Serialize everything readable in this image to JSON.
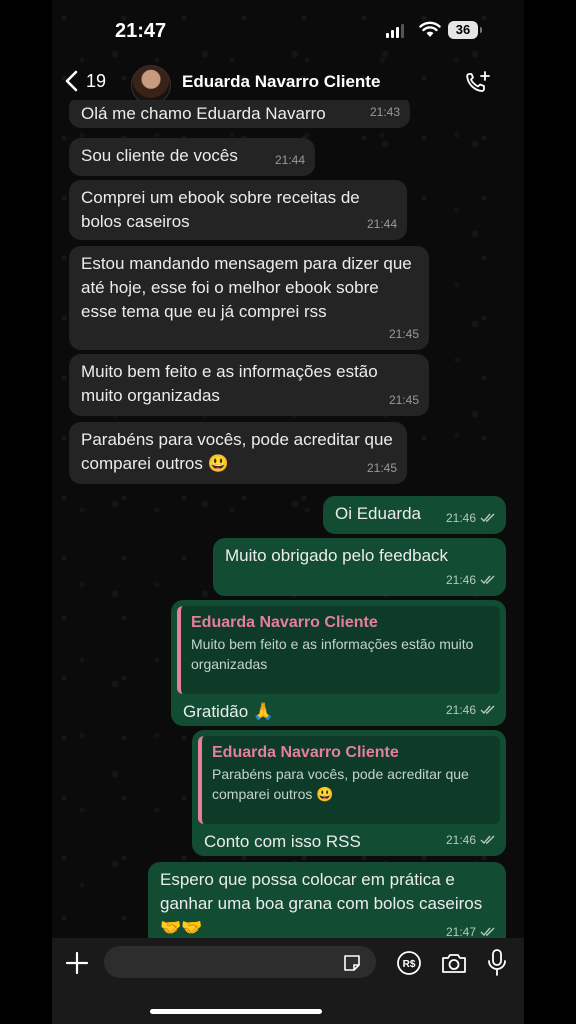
{
  "status_bar": {
    "time": "21:47",
    "battery": "36"
  },
  "header": {
    "back_count": "19",
    "contact_name": "Eduarda Navarro Cliente"
  },
  "messages": [
    {
      "text": "Olá me chamo Eduarda Navarro",
      "time": "21:43"
    },
    {
      "text": "Sou cliente de vocês",
      "time": "21:44"
    },
    {
      "text": "Comprei um ebook sobre receitas de bolos caseiros",
      "time": "21:44"
    },
    {
      "text": "Estou mandando mensagem para dizer que até hoje, esse foi o melhor ebook sobre esse tema que eu já comprei rss",
      "time": "21:45"
    },
    {
      "text": "Muito bem feito e as informações estão muito organizadas",
      "time": "21:45"
    },
    {
      "text": "Parabéns para vocês, pode acreditar que comparei outros 😃",
      "time": "21:45"
    },
    {
      "text": "Oi Eduarda",
      "time": "21:46"
    },
    {
      "text": "Muito obrigado pelo feedback",
      "time": "21:46"
    },
    {
      "quote_author": "Eduarda Navarro Cliente",
      "quote_text": "Muito bem feito e as informações estão muito organizadas",
      "text": "Gratidão 🙏",
      "time": "21:46"
    },
    {
      "quote_author": "Eduarda Navarro Cliente",
      "quote_text": "Parabéns para vocês, pode acreditar que comparei outros 😃",
      "text": "Conto com isso RSS",
      "time": "21:46"
    },
    {
      "text": "Espero que possa colocar em prática e ganhar uma boa grana com bolos caseiros 🤝🤝",
      "time": "21:47"
    }
  ],
  "composer": {
    "payment_icon_label": "R$"
  },
  "colors": {
    "incoming_bubble": "#242424",
    "outgoing_bubble": "#124c33",
    "quote_accent": "#e57f9b"
  },
  "icons": [
    "chevron-left-icon",
    "add-call-icon",
    "plus-icon",
    "sticker-icon",
    "payment-icon",
    "camera-icon",
    "microphone-icon",
    "double-check-icon"
  ]
}
